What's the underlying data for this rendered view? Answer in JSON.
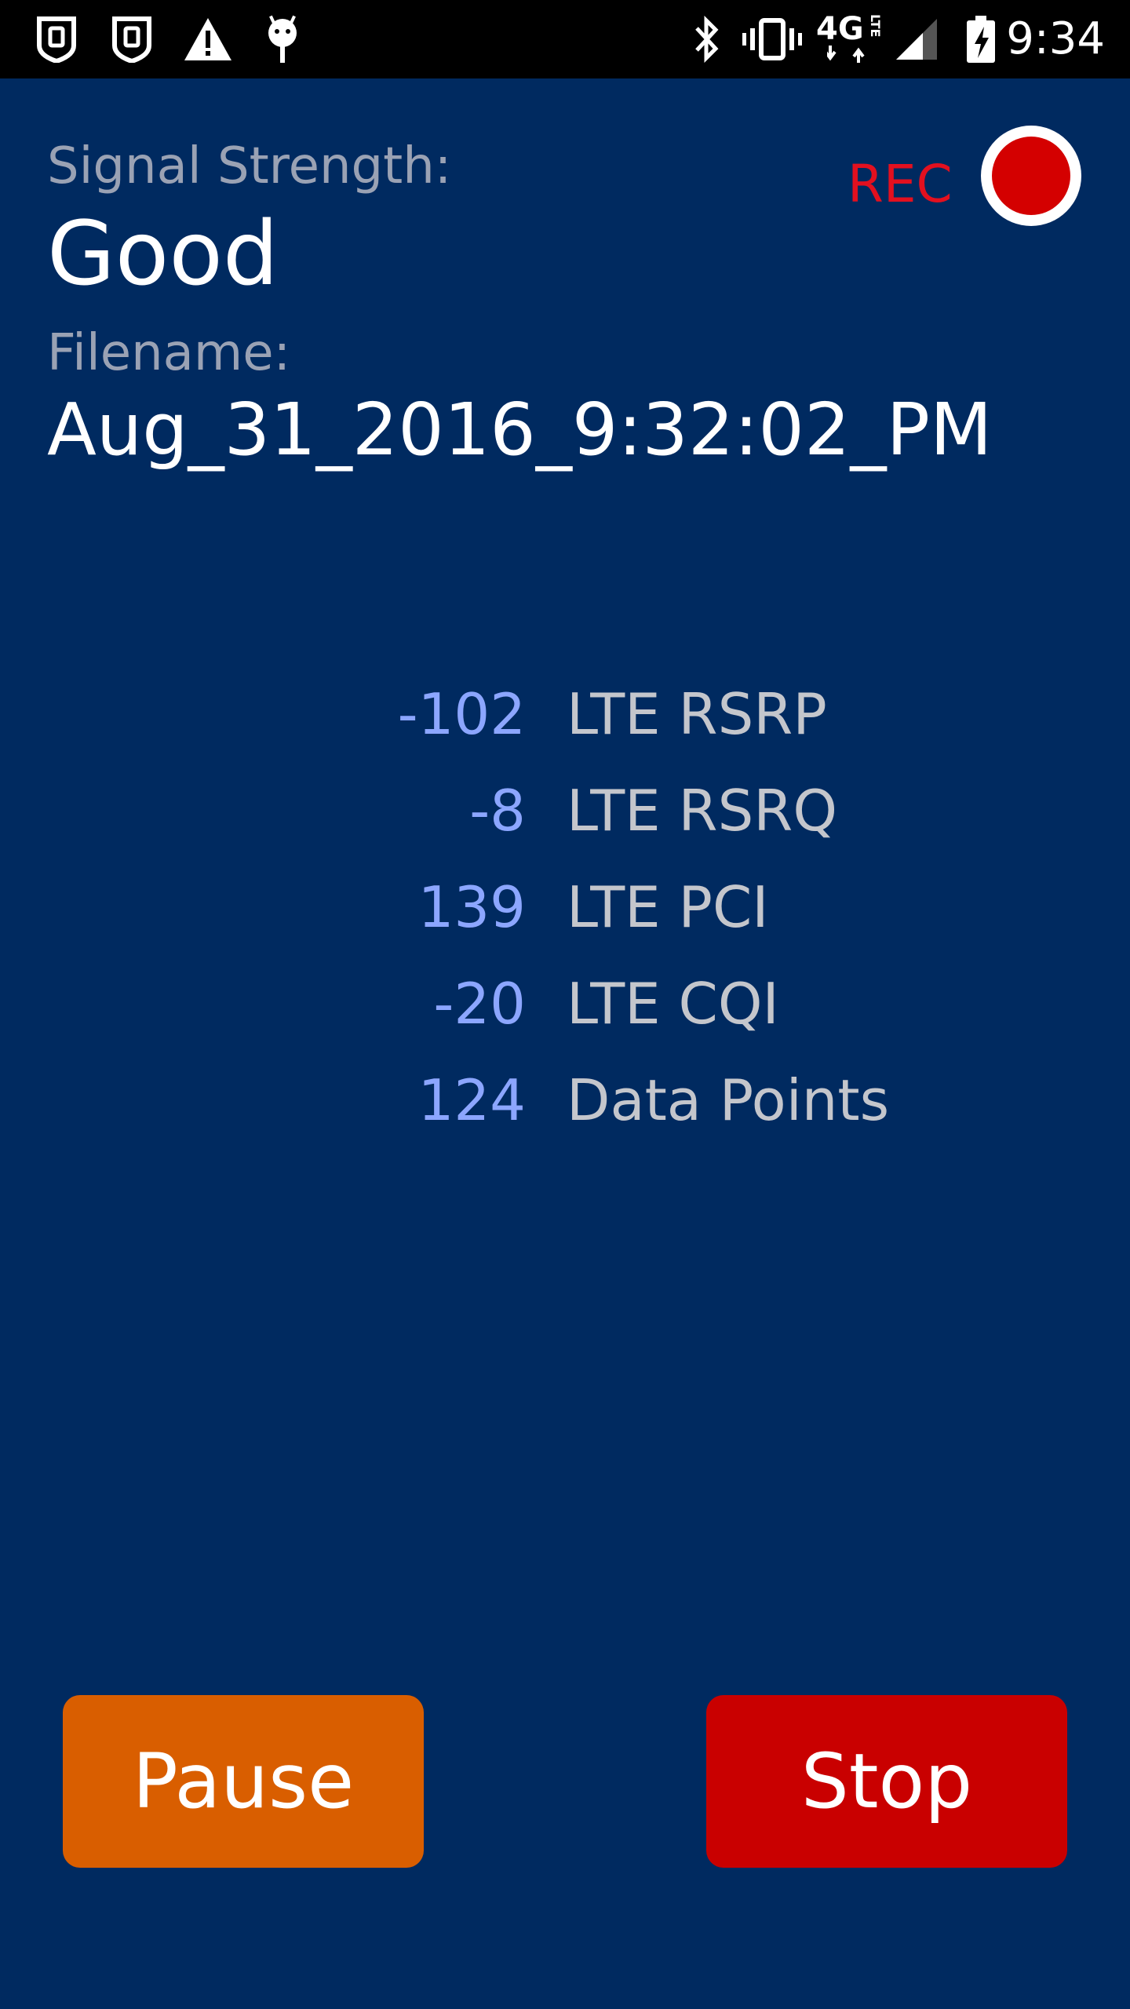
{
  "status_bar": {
    "time": "9:34",
    "network_label": "4G",
    "network_sub": "LTE",
    "icons": [
      "shield-icon",
      "shield-icon",
      "warning-icon",
      "android-debug-icon",
      "bluetooth-icon",
      "vibrate-icon",
      "network-4g-lte-icon",
      "signal-icon",
      "battery-charging-icon"
    ]
  },
  "signal": {
    "label": "Signal Strength:",
    "value": "Good"
  },
  "file": {
    "label": "Filename:",
    "value": "Aug_31_2016_9:32:02_PM"
  },
  "recording": {
    "label": "REC",
    "indicator_color": "#d40000"
  },
  "stats": [
    {
      "value": "-102",
      "label": "LTE RSRP"
    },
    {
      "value": "-8",
      "label": "LTE RSRQ"
    },
    {
      "value": "139",
      "label": "LTE PCI"
    },
    {
      "value": "-20",
      "label": "LTE CQI"
    },
    {
      "value": "124",
      "label": "Data Points"
    }
  ],
  "buttons": {
    "pause": "Pause",
    "stop": "Stop"
  },
  "colors": {
    "background": "#002a60",
    "pause_button": "#d95e00",
    "stop_button": "#c90000",
    "stat_value": "#8ca6ff",
    "rec": "#e3101f"
  }
}
